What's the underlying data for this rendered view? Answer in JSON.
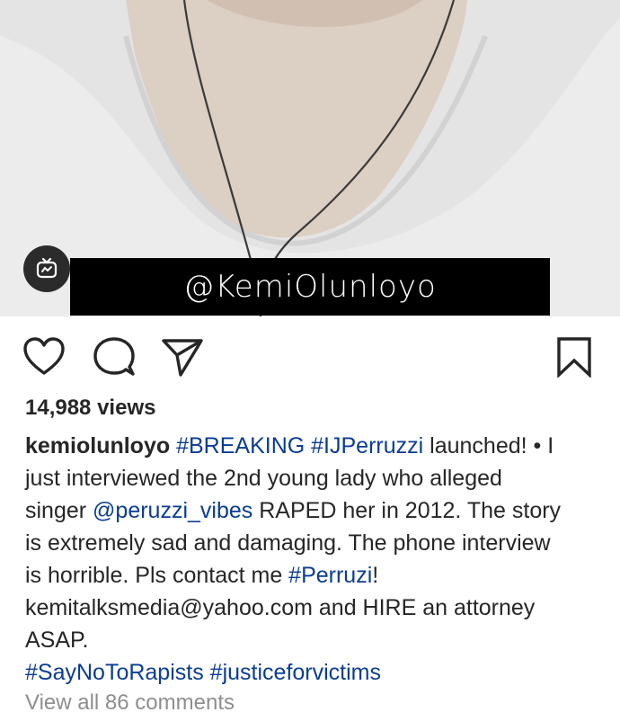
{
  "media": {
    "watermark": "@KemiOlunloyo",
    "badge_icon": "igtv-icon"
  },
  "actions": {
    "like_icon": "heart-icon",
    "comment_icon": "comment-icon",
    "share_icon": "send-icon",
    "save_icon": "bookmark-icon"
  },
  "post": {
    "views": "14,988 views",
    "username": "kemiolunloyo",
    "caption_lines": [
      [
        {
          "t": "tag",
          "v": "#BREAKING"
        },
        {
          "t": "text",
          "v": " "
        },
        {
          "t": "tag",
          "v": "#IJPerruzzi"
        },
        {
          "t": "text",
          "v": " launched! • I"
        }
      ],
      [
        {
          "t": "text",
          "v": "just interviewed the 2nd young lady who alleged"
        }
      ],
      [
        {
          "t": "text",
          "v": "singer "
        },
        {
          "t": "tag",
          "v": "@peruzzi_vibes"
        },
        {
          "t": "text",
          "v": " RAPED her in 2012. The story"
        }
      ],
      [
        {
          "t": "text",
          "v": "is extremely sad and damaging. The phone interview"
        }
      ],
      [
        {
          "t": "text",
          "v": "is horrible. Pls contact me "
        },
        {
          "t": "tag",
          "v": "#Perruzi"
        },
        {
          "t": "text",
          "v": "!"
        }
      ],
      [
        {
          "t": "text",
          "v": "kemitalksmedia@yahoo.com and HIRE an attorney"
        }
      ],
      [
        {
          "t": "text",
          "v": "ASAP."
        }
      ],
      [
        {
          "t": "tag",
          "v": "#SayNoToRapists"
        },
        {
          "t": "text",
          "v": " "
        },
        {
          "t": "tag",
          "v": "#justiceforvictims"
        }
      ]
    ],
    "view_all_comments": "View all 86 comments"
  },
  "colors": {
    "tag": "#0b3d91",
    "muted": "#8e8e8e",
    "text": "#262626"
  }
}
